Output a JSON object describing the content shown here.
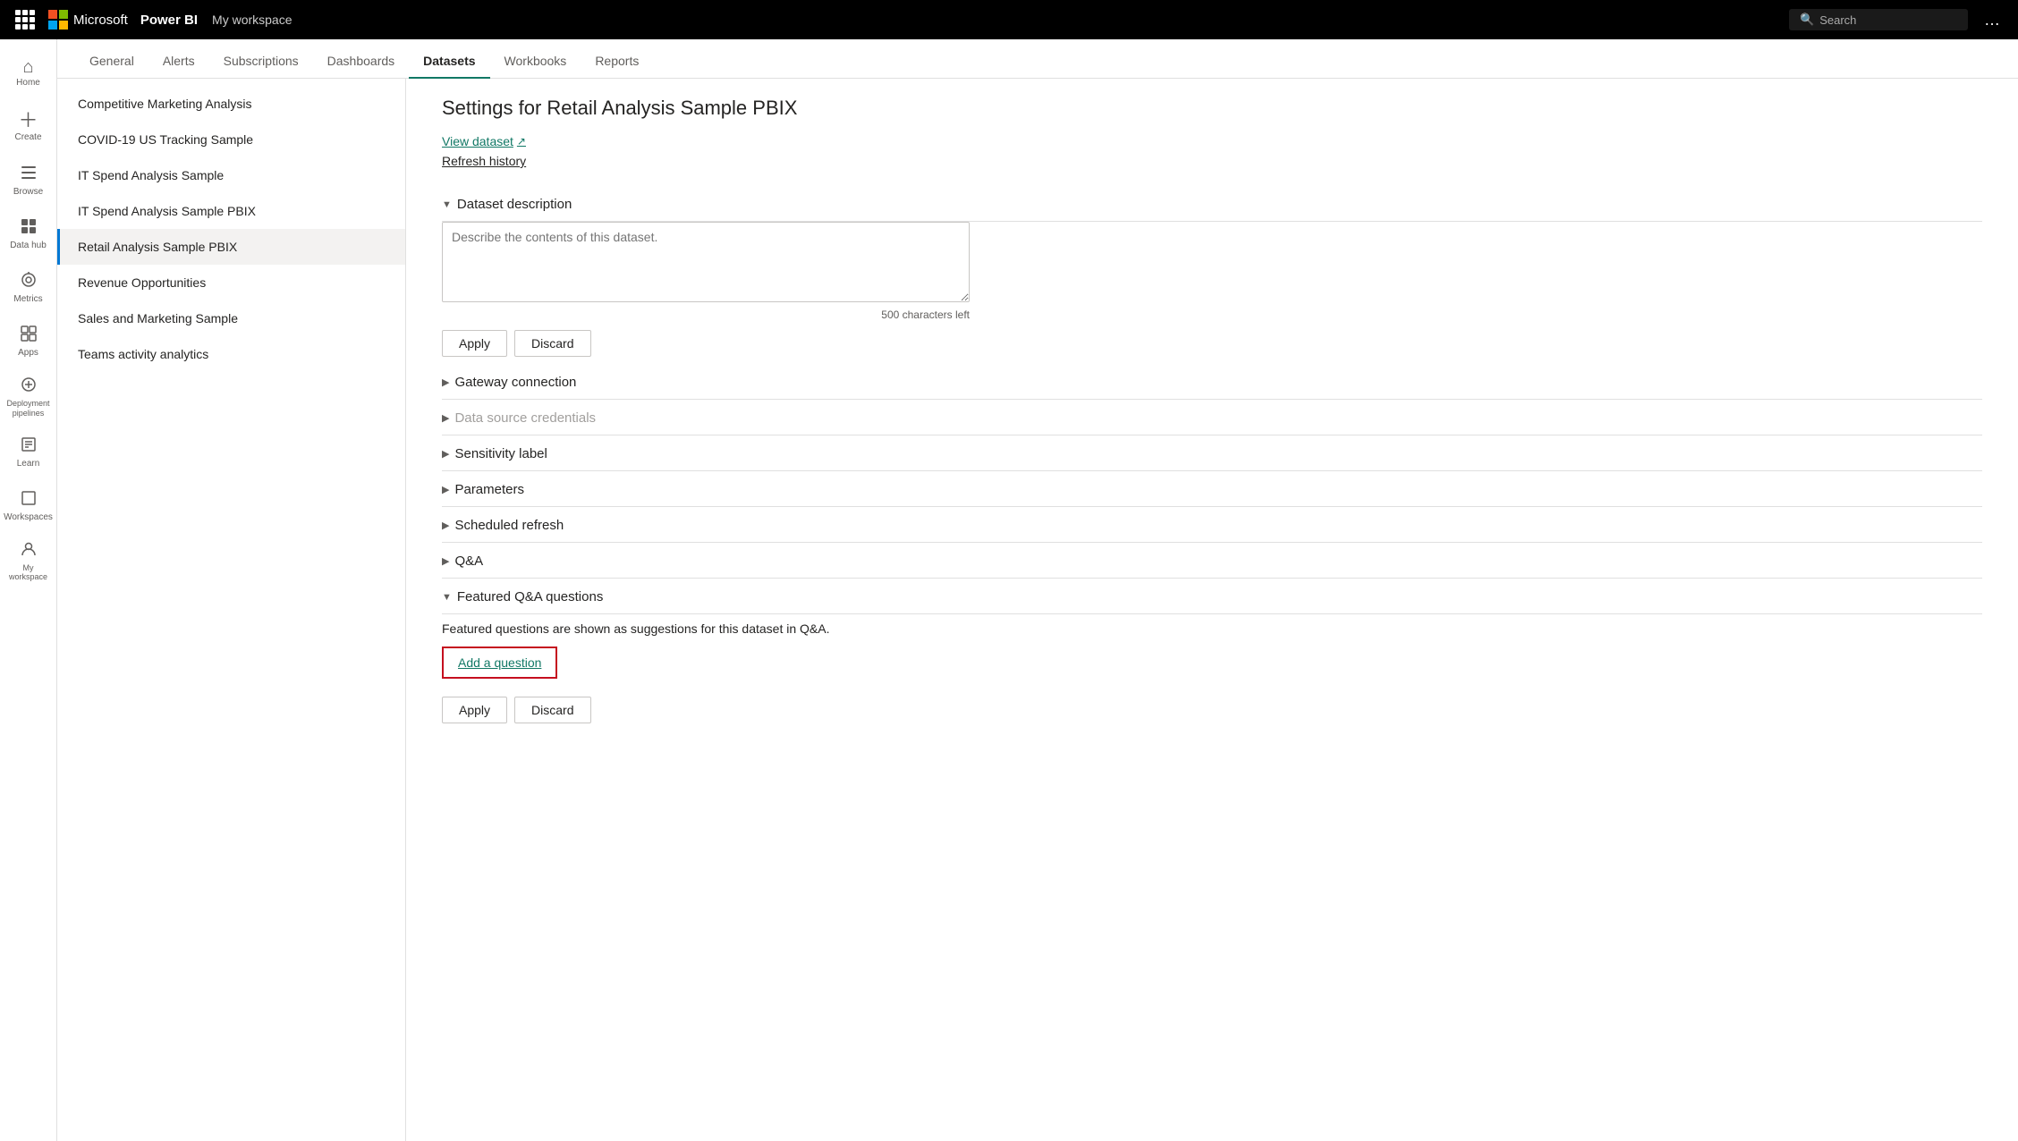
{
  "topbar": {
    "app_name": "Power BI",
    "workspace": "My workspace",
    "search_placeholder": "Search",
    "more_icon": "…"
  },
  "sidebar": {
    "items": [
      {
        "id": "home",
        "icon": "⌂",
        "label": "Home"
      },
      {
        "id": "create",
        "icon": "+",
        "label": "Create"
      },
      {
        "id": "browse",
        "icon": "☰",
        "label": "Browse"
      },
      {
        "id": "datahub",
        "icon": "⊞",
        "label": "Data hub"
      },
      {
        "id": "metrics",
        "icon": "◎",
        "label": "Metrics"
      },
      {
        "id": "apps",
        "icon": "⊟",
        "label": "Apps"
      },
      {
        "id": "deployment",
        "icon": "⊙",
        "label": "Deployment pipelines"
      },
      {
        "id": "learn",
        "icon": "📖",
        "label": "Learn"
      },
      {
        "id": "workspaces",
        "icon": "⬜",
        "label": "Workspaces"
      },
      {
        "id": "myworkspace",
        "icon": "👤",
        "label": "My workspace"
      }
    ]
  },
  "tabs": [
    {
      "id": "general",
      "label": "General"
    },
    {
      "id": "alerts",
      "label": "Alerts"
    },
    {
      "id": "subscriptions",
      "label": "Subscriptions"
    },
    {
      "id": "dashboards",
      "label": "Dashboards"
    },
    {
      "id": "datasets",
      "label": "Datasets",
      "active": true
    },
    {
      "id": "workbooks",
      "label": "Workbooks"
    },
    {
      "id": "reports",
      "label": "Reports"
    }
  ],
  "dataset_list": [
    {
      "id": "competitive",
      "label": "Competitive Marketing Analysis"
    },
    {
      "id": "covid",
      "label": "COVID-19 US Tracking Sample"
    },
    {
      "id": "itspend",
      "label": "IT Spend Analysis Sample"
    },
    {
      "id": "itspendpbix",
      "label": "IT Spend Analysis Sample PBIX"
    },
    {
      "id": "retail",
      "label": "Retail Analysis Sample PBIX",
      "active": true
    },
    {
      "id": "revenue",
      "label": "Revenue Opportunities"
    },
    {
      "id": "salesmarketing",
      "label": "Sales and Marketing Sample"
    },
    {
      "id": "teams",
      "label": "Teams activity analytics"
    }
  ],
  "settings": {
    "title": "Settings for Retail Analysis Sample PBIX",
    "view_dataset_link": "View dataset",
    "refresh_history_link": "Refresh history",
    "sections": {
      "dataset_description": {
        "label": "Dataset description",
        "expanded": true,
        "textarea_placeholder": "Describe the contents of this dataset.",
        "char_count": "500 characters left",
        "apply_label": "Apply",
        "discard_label": "Discard"
      },
      "gateway": {
        "label": "Gateway connection",
        "expanded": false
      },
      "datasource": {
        "label": "Data source credentials",
        "expanded": false,
        "disabled": true
      },
      "sensitivity": {
        "label": "Sensitivity label",
        "expanded": false
      },
      "parameters": {
        "label": "Parameters",
        "expanded": false
      },
      "scheduled_refresh": {
        "label": "Scheduled refresh",
        "expanded": false
      },
      "qa": {
        "label": "Q&A",
        "expanded": false
      },
      "featured_qa": {
        "label": "Featured Q&A questions",
        "expanded": true,
        "description": "Featured questions are shown as suggestions for this dataset in Q&A.",
        "add_question_label": "Add a question",
        "apply_label": "Apply",
        "discard_label": "Discard"
      }
    }
  }
}
